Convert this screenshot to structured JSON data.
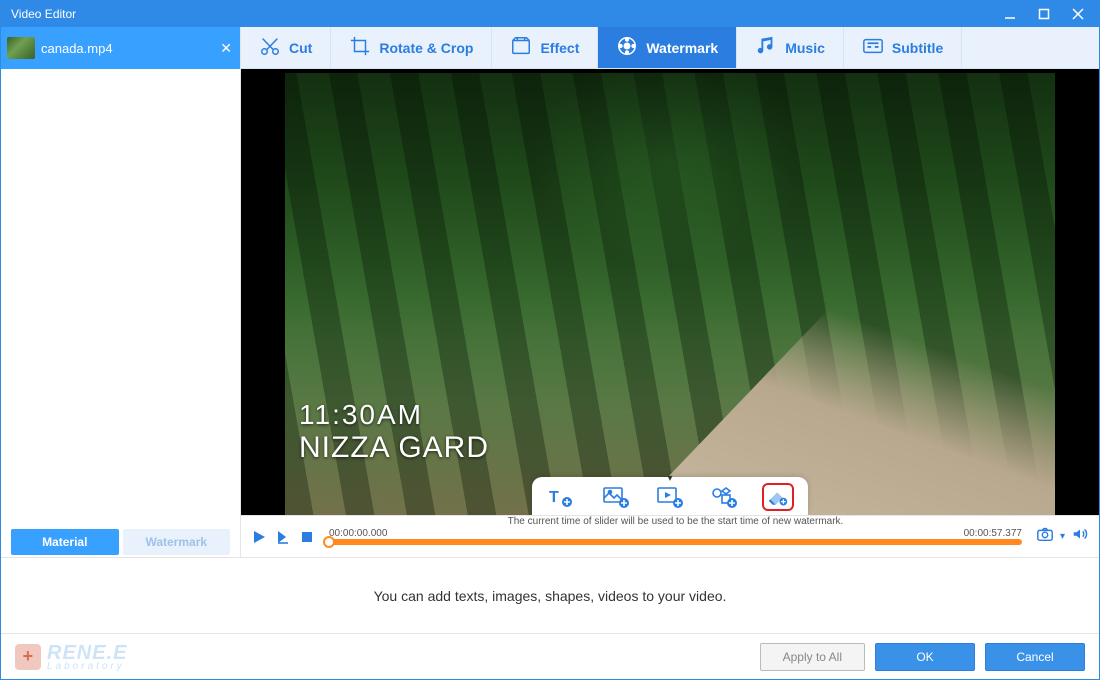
{
  "titlebar": {
    "title": "Video Editor"
  },
  "sidebar": {
    "file": {
      "name": "canada.mp4"
    },
    "tabs": [
      {
        "label": "Material",
        "active": true
      },
      {
        "label": "Watermark",
        "active": false
      }
    ]
  },
  "tooltabs": [
    {
      "id": "cut",
      "label": "Cut"
    },
    {
      "id": "rotate",
      "label": "Rotate & Crop"
    },
    {
      "id": "effect",
      "label": "Effect"
    },
    {
      "id": "watermark",
      "label": "Watermark",
      "active": true
    },
    {
      "id": "music",
      "label": "Music"
    },
    {
      "id": "subtitle",
      "label": "Subtitle"
    }
  ],
  "preview": {
    "overlay_line1": "11:30AM",
    "overlay_line2": "NIZZA GARD"
  },
  "wm_toolbar_hint": "The current time of slider will be used to be the start time of new watermark.",
  "timeline": {
    "start": "00:00:00.000",
    "end": "00:00:57.377"
  },
  "message": "You can add texts, images, shapes, videos to your video.",
  "footer": {
    "brand_main": "RENE.E",
    "brand_sub": "Laboratory",
    "apply_all": "Apply to All",
    "ok": "OK",
    "cancel": "Cancel"
  }
}
